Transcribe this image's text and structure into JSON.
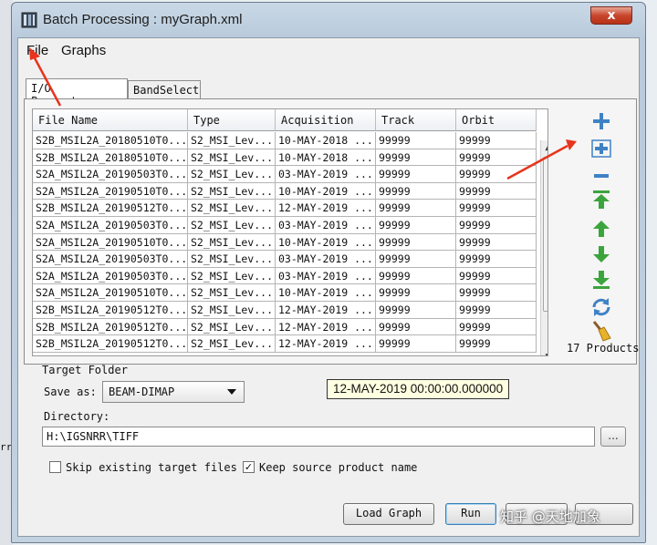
{
  "window": {
    "title": "Batch Processing : myGraph.xml",
    "close_label": "x"
  },
  "menu": {
    "items": [
      "File",
      "Graphs"
    ]
  },
  "tabs": [
    "I/O Parameters",
    "BandSelect"
  ],
  "table": {
    "columns": [
      "File Name",
      "Type",
      "Acquisition",
      "Track",
      "Orbit"
    ],
    "rows": [
      [
        "S2B_MSIL2A_20180510T0...",
        "S2_MSI_Lev...",
        "10-MAY-2018 ...",
        "99999",
        "99999"
      ],
      [
        "S2B_MSIL2A_20180510T0...",
        "S2_MSI_Lev...",
        "10-MAY-2018 ...",
        "99999",
        "99999"
      ],
      [
        "S2A_MSIL2A_20190503T0...",
        "S2_MSI_Lev...",
        "03-MAY-2019 ...",
        "99999",
        "99999"
      ],
      [
        "S2A_MSIL2A_20190510T0...",
        "S2_MSI_Lev...",
        "10-MAY-2019 ...",
        "99999",
        "99999"
      ],
      [
        "S2B_MSIL2A_20190512T0...",
        "S2_MSI_Lev...",
        "12-MAY-2019 ...",
        "99999",
        "99999"
      ],
      [
        "S2A_MSIL2A_20190503T0...",
        "S2_MSI_Lev...",
        "03-MAY-2019 ...",
        "99999",
        "99999"
      ],
      [
        "S2A_MSIL2A_20190510T0...",
        "S2_MSI_Lev...",
        "10-MAY-2019 ...",
        "99999",
        "99999"
      ],
      [
        "S2A_MSIL2A_20190503T0...",
        "S2_MSI_Lev...",
        "03-MAY-2019 ...",
        "99999",
        "99999"
      ],
      [
        "S2A_MSIL2A_20190503T0...",
        "S2_MSI_Lev...",
        "03-MAY-2019 ...",
        "99999",
        "99999"
      ],
      [
        "S2A_MSIL2A_20190510T0...",
        "S2_MSI_Lev...",
        "10-MAY-2019 ...",
        "99999",
        "99999"
      ],
      [
        "S2B_MSIL2A_20190512T0...",
        "S2_MSI_Lev...",
        "12-MAY-2019 ...",
        "99999",
        "99999"
      ],
      [
        "S2B_MSIL2A_20190512T0...",
        "S2_MSI_Lev...",
        "12-MAY-2019 ...",
        "99999",
        "99999"
      ],
      [
        "S2B_MSIL2A_20190512T0...",
        "S2_MSI_Lev...",
        "12-MAY-2019 ...",
        "99999",
        "99999"
      ]
    ]
  },
  "side_toolbar": {
    "icons": [
      "add-icon",
      "add-all-icon",
      "remove-icon",
      "move-top-icon",
      "move-up-icon",
      "move-down-icon",
      "move-bottom-icon",
      "refresh-icon",
      "clear-broom-icon"
    ],
    "products_count": "17 Products"
  },
  "target_folder": {
    "title": "Target Folder",
    "save_as_label": "Save as:",
    "save_as_value": "BEAM-DIMAP",
    "tooltip": "12-MAY-2019 00:00:00.000000",
    "directory_label": "Directory:",
    "directory_value": "H:\\IGSNRR\\TIFF",
    "browse_label": "...",
    "skip_label": "Skip existing target files",
    "skip_checked": false,
    "keep_label": "Keep source product name",
    "keep_checked": true
  },
  "buttons": {
    "load_graph": "Load Graph",
    "run": "Run"
  },
  "watermark": "知乎 @天地加象",
  "left_edge_text": "rr",
  "colors": {
    "accent_blue": "#3f82c4",
    "accent_green": "#3ca43c",
    "annotation_red": "#e8341c"
  }
}
